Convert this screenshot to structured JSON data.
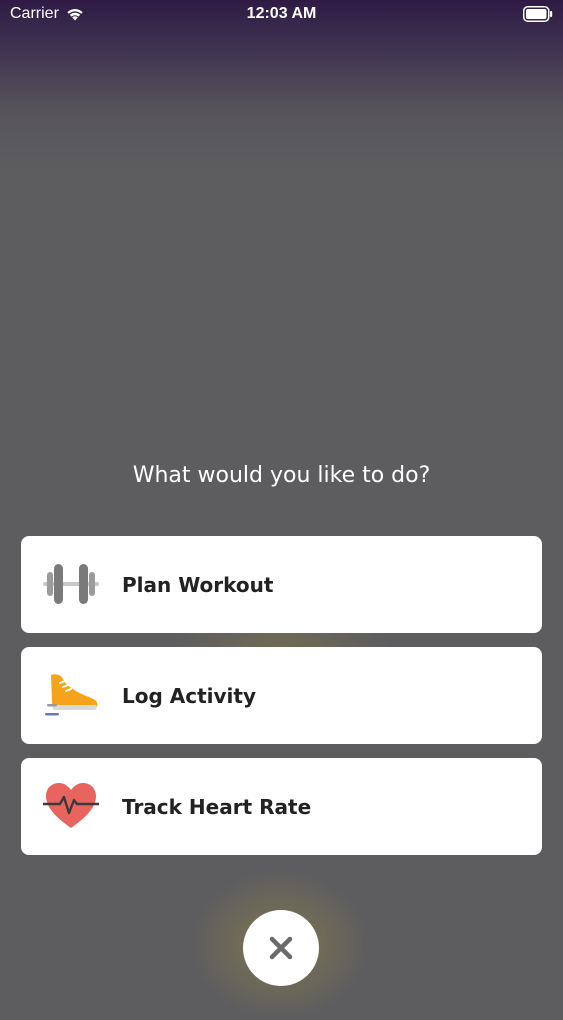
{
  "status_bar": {
    "carrier": "Carrier",
    "time": "12:03 AM"
  },
  "prompt": "What would you like to do?",
  "options": [
    {
      "label": "Plan Workout",
      "icon": "dumbbell-icon"
    },
    {
      "label": "Log Activity",
      "icon": "sneaker-icon"
    },
    {
      "label": "Track Heart Rate",
      "icon": "heart-rate-icon"
    }
  ],
  "close_icon": "close-icon",
  "colors": {
    "overlay": "#5d5d60",
    "top_gradient": "#2f1a44",
    "card": "#ffffff",
    "sneaker": "#f5a31a",
    "heart": "#e8655f"
  }
}
